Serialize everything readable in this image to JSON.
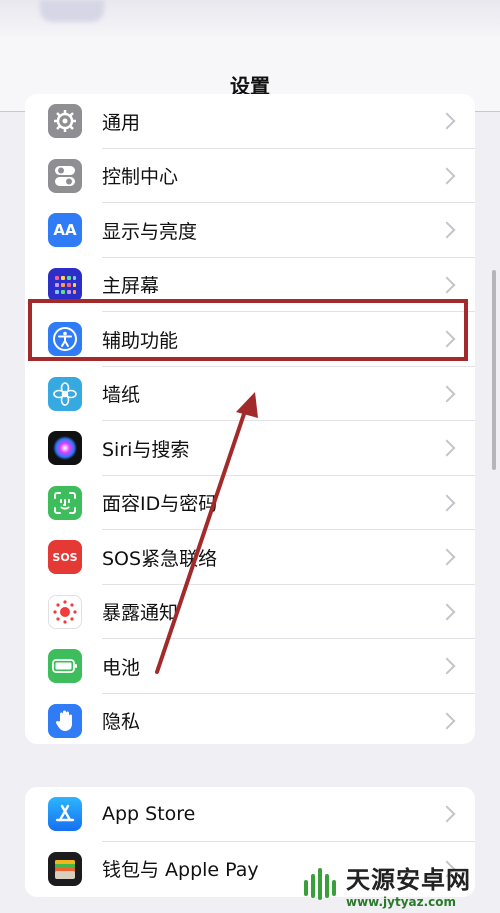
{
  "nav": {
    "title": "设置"
  },
  "group1": [
    {
      "label": "通用",
      "icon": "gear-icon",
      "color": "#8e8e93"
    },
    {
      "label": "控制中心",
      "icon": "toggle-switches-icon",
      "color": "#8e8e93"
    },
    {
      "label": "显示与亮度",
      "icon": "text-size-aa-icon",
      "color": "#2f7cf6"
    },
    {
      "label": "主屏幕",
      "icon": "app-grid-icon",
      "color": "#3b3bd6"
    },
    {
      "label": "辅助功能",
      "icon": "accessibility-person-icon",
      "color": "#2f7cf6"
    },
    {
      "label": "墙纸",
      "icon": "flower-icon",
      "color": "#36a9e1"
    },
    {
      "label": "Siri与搜索",
      "icon": "siri-orb-icon",
      "color": "#222222"
    },
    {
      "label": "面容ID与密码",
      "icon": "face-id-icon",
      "color": "#3dbd5c"
    },
    {
      "label": "SOS紧急联络",
      "icon": "sos-icon",
      "color": "#e53935",
      "icon_text": "SOS"
    },
    {
      "label": "暴露通知",
      "icon": "exposure-dots-icon",
      "color": "#ffffff"
    },
    {
      "label": "电池",
      "icon": "battery-icon",
      "color": "#3dbd5c"
    },
    {
      "label": "隐私",
      "icon": "hand-icon",
      "color": "#2f7cf6"
    }
  ],
  "group2": [
    {
      "label": "App Store",
      "icon": "app-store-icon",
      "color": "#1e90ff"
    },
    {
      "label": "钱包与 Apple Pay",
      "icon": "wallet-icon",
      "color": "#222222"
    }
  ],
  "annotation": {
    "highlight_color": "#a22a2a"
  },
  "watermark": {
    "title": "天源安卓网",
    "url": "www.jytyaz.com"
  }
}
